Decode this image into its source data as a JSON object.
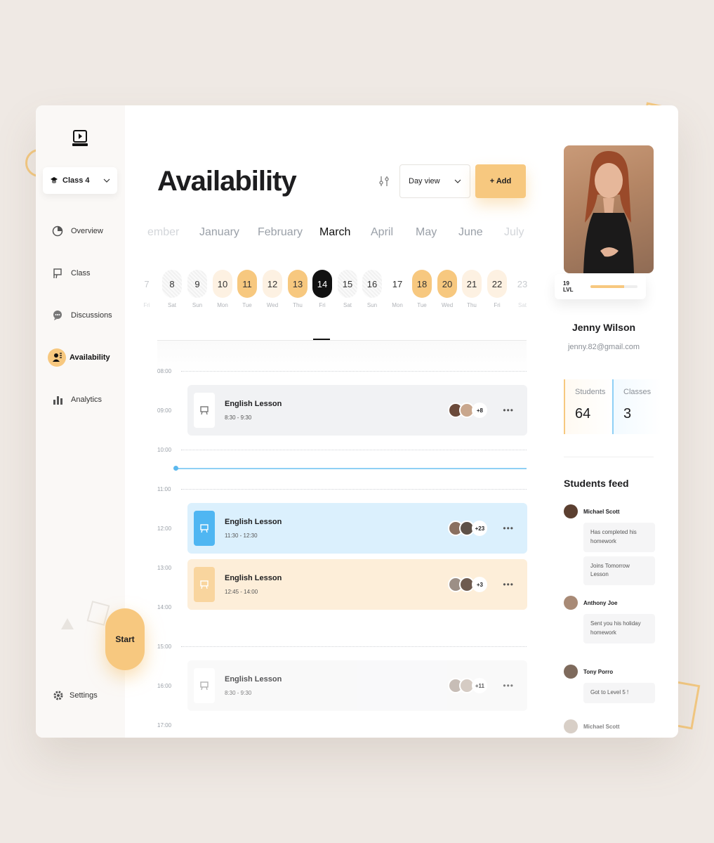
{
  "sidebar": {
    "class_select": "Class 4",
    "nav": [
      {
        "label": "Overview",
        "icon": "overview-icon"
      },
      {
        "label": "Class",
        "icon": "class-icon"
      },
      {
        "label": "Discussions",
        "icon": "discussions-icon"
      },
      {
        "label": "Availability",
        "icon": "availability-icon",
        "active": true
      },
      {
        "label": "Analytics",
        "icon": "analytics-icon"
      }
    ],
    "start": "Start",
    "settings": "Settings"
  },
  "header": {
    "title": "Availability",
    "view_select": "Day view",
    "add_label": "+ Add"
  },
  "months": [
    "ember",
    "January",
    "February",
    "March",
    "April",
    "May",
    "June",
    "July"
  ],
  "active_month": "March",
  "days": [
    {
      "num": "7",
      "dn": "Fri",
      "style": "faded"
    },
    {
      "num": "8",
      "dn": "Sat",
      "style": "hatch"
    },
    {
      "num": "9",
      "dn": "Sun",
      "style": "hatch"
    },
    {
      "num": "10",
      "dn": "Mon",
      "style": "light"
    },
    {
      "num": "11",
      "dn": "Tue",
      "style": "gold"
    },
    {
      "num": "12",
      "dn": "Wed",
      "style": "light"
    },
    {
      "num": "13",
      "dn": "Thu",
      "style": "gold"
    },
    {
      "num": "14",
      "dn": "Fri",
      "style": "black"
    },
    {
      "num": "15",
      "dn": "Sat",
      "style": "hatch"
    },
    {
      "num": "16",
      "dn": "Sun",
      "style": "hatch"
    },
    {
      "num": "17",
      "dn": "Mon",
      "style": "plain"
    },
    {
      "num": "18",
      "dn": "Tue",
      "style": "gold"
    },
    {
      "num": "20",
      "dn": "Wed",
      "style": "gold"
    },
    {
      "num": "21",
      "dn": "Thu",
      "style": "light"
    },
    {
      "num": "22",
      "dn": "Fri",
      "style": "light"
    },
    {
      "num": "23",
      "dn": "Sat",
      "style": "faded"
    }
  ],
  "times": [
    "08:00",
    "09:00",
    "10:00",
    "11:00",
    "12:00",
    "13:00",
    "14:00",
    "15:00",
    "16:00",
    "17:00"
  ],
  "events": [
    {
      "title": "English Lesson",
      "time": "8:30 - 9:30",
      "more": "+8",
      "style": "grey"
    },
    {
      "title": "English Lesson",
      "time": "11:30 - 12:30",
      "more": "+23",
      "style": "blue"
    },
    {
      "title": "English Lesson",
      "time": "12:45 - 14:00",
      "more": "+3",
      "style": "orange"
    },
    {
      "title": "English Lesson",
      "time": "8:30 - 9:30",
      "more": "+11",
      "style": "faded"
    }
  ],
  "profile": {
    "level": "19 LVL",
    "level_progress": 0.72,
    "name": "Jenny Wilson",
    "email": "jenny.82@gmail.com",
    "students_label": "Students",
    "students_value": "64",
    "classes_label": "Classes",
    "classes_value": "3"
  },
  "feed": {
    "title": "Students feed",
    "items": [
      {
        "name": "Michael Scott",
        "messages": [
          "Has completed his homework",
          "Joins Tomorrow Lesson"
        ]
      },
      {
        "name": "Anthony Joe",
        "messages": [
          "Sent you his holiday homework"
        ]
      },
      {
        "name": "Tony Porro",
        "messages": [
          "Got to Level 5 !"
        ]
      },
      {
        "name": "Michael Scott",
        "messages": []
      }
    ]
  },
  "colors": {
    "accent": "#f7c87f",
    "blue": "#4fb6f2",
    "background": "#efe9e4"
  }
}
